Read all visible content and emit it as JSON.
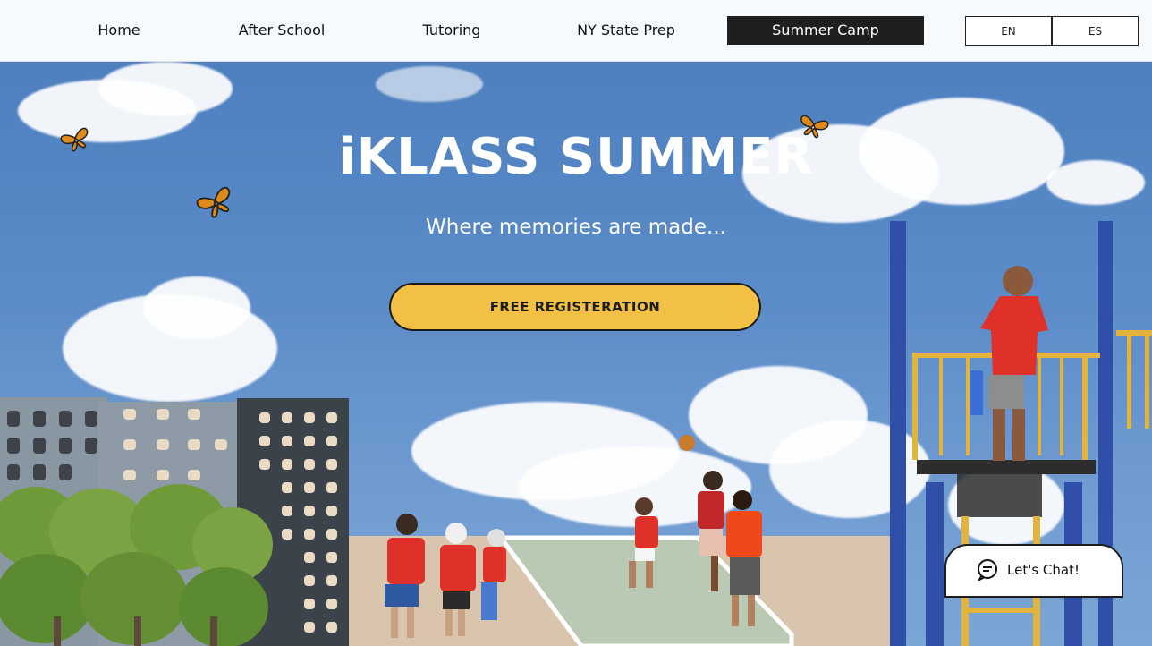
{
  "nav": {
    "items": [
      {
        "label": "Home"
      },
      {
        "label": "After School"
      },
      {
        "label": "Tutoring"
      },
      {
        "label": "NY State Prep"
      },
      {
        "label": "Summer Camp"
      }
    ],
    "active": "Summer Camp",
    "languages": [
      "EN",
      "ES"
    ]
  },
  "hero": {
    "title": "iKLASS SUMMER",
    "subtitle": "Where memories are made...",
    "cta_label": "FREE REGISTERATION"
  },
  "chat": {
    "label": "Let's Chat!",
    "icon": "chat-bubble-icon"
  },
  "colors": {
    "accent": "#f2c045",
    "sky": "#5b8bc8",
    "nav_active_bg": "#1f1f1f",
    "shirt_red": "#e0302a"
  }
}
